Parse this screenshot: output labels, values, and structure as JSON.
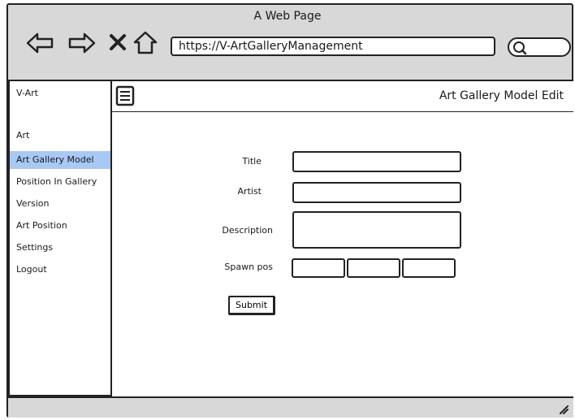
{
  "window": {
    "title": "A Web Page"
  },
  "browser": {
    "url": "https://V-ArtGalleryManagement",
    "icons": [
      "back-arrow-icon",
      "forward-arrow-icon",
      "close-icon",
      "home-icon",
      "search-icon"
    ]
  },
  "sidebar": {
    "brand": "V-Art",
    "items": [
      {
        "label": "Art"
      },
      {
        "label": "Art Gallery Model",
        "active": true
      },
      {
        "label": "Position In Gallery"
      },
      {
        "label": "Version"
      },
      {
        "label": "Art Position"
      },
      {
        "label": "Settings"
      },
      {
        "label": "Logout"
      }
    ],
    "active_color": "#a9c8f5"
  },
  "header": {
    "title": "Art Gallery Model Edit"
  },
  "form": {
    "title_label": "Title",
    "artist_label": "Artist",
    "description_label": "Description",
    "spawn_label": "Spawn pos",
    "title_value": "",
    "artist_value": "",
    "description_value": "",
    "spawn_x": "",
    "spawn_y": "",
    "spawn_z": "",
    "submit_label": "Submit"
  }
}
